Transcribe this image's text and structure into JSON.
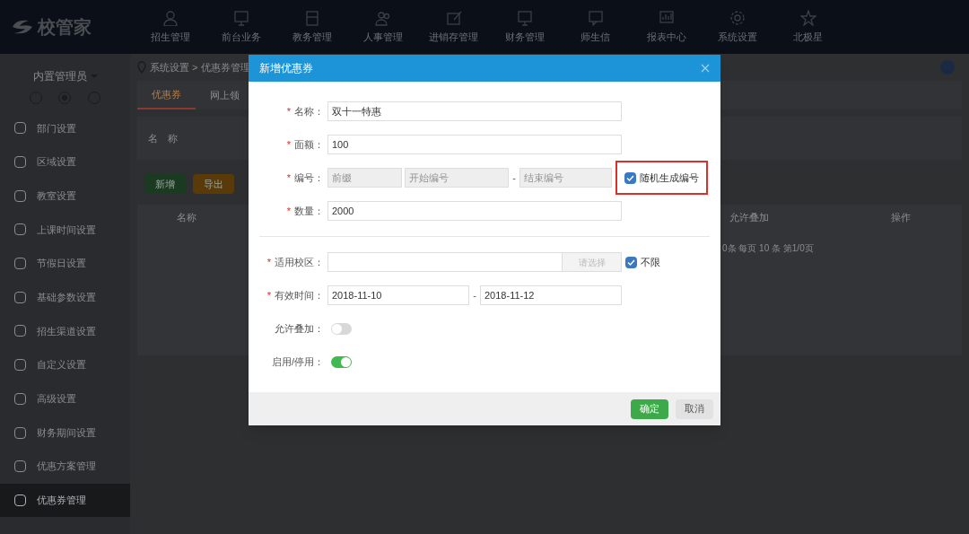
{
  "app": {
    "logo": "校管家"
  },
  "nav": [
    {
      "label": "招生管理"
    },
    {
      "label": "前台业务"
    },
    {
      "label": "教务管理"
    },
    {
      "label": "人事管理"
    },
    {
      "label": "进销存管理"
    },
    {
      "label": "财务管理"
    },
    {
      "label": "师生信"
    },
    {
      "label": "报表中心"
    },
    {
      "label": "系统设置"
    },
    {
      "label": "北极星"
    }
  ],
  "user": {
    "name": "内置管理员"
  },
  "sidebar": {
    "items": [
      {
        "label": "部门设置",
        "selected": false
      },
      {
        "label": "区域设置",
        "selected": false
      },
      {
        "label": "教室设置",
        "selected": false
      },
      {
        "label": "上课时间设置",
        "selected": false
      },
      {
        "label": "节假日设置",
        "selected": false
      },
      {
        "label": "基础参数设置",
        "selected": false
      },
      {
        "label": "招生渠道设置",
        "selected": false
      },
      {
        "label": "自定义设置",
        "selected": false
      },
      {
        "label": "高级设置",
        "selected": false
      },
      {
        "label": "财务期间设置",
        "selected": false
      },
      {
        "label": "优惠方案管理",
        "selected": false
      },
      {
        "label": "优惠券管理",
        "selected": true
      }
    ]
  },
  "breadcrumb": "系统设置 > 优惠券管理",
  "tabs": [
    {
      "label": "优惠券",
      "selected": true
    },
    {
      "label": "网上领",
      "selected": false
    }
  ],
  "filter": {
    "label": "名　称"
  },
  "buttons": [
    "新增",
    "导出"
  ],
  "table": {
    "columns": [
      "名称",
      "允许叠加",
      "操作"
    ]
  },
  "pagination": "0条 每页 10 条 第1/0页",
  "dialog": {
    "title": "新增优惠券",
    "fields": [
      {
        "kind": "text",
        "mark": "*",
        "label": "名称：",
        "value": "双十一特惠"
      },
      {
        "kind": "text",
        "mark": "*",
        "label": "面额：",
        "value": "100"
      },
      {
        "kind": "code",
        "mark": "*",
        "label": "编号：",
        "placeholders": [
          "前缀",
          "开始编号",
          "结束编号"
        ],
        "separator": "-",
        "option": {
          "label": "随机生成编号",
          "checked": true,
          "highlighted": true
        }
      },
      {
        "kind": "text",
        "mark": "*",
        "label": "数量：",
        "value": "2000"
      },
      {
        "kind": "divider"
      },
      {
        "kind": "pick",
        "mark": "*",
        "label": "适用校区：",
        "button": "请选择",
        "option": {
          "label": "不限",
          "checked": true
        }
      },
      {
        "kind": "range",
        "mark": "*",
        "label": "有效时间：",
        "values": [
          "2018-11-10",
          "2018-11-12"
        ],
        "separator": "-"
      },
      {
        "kind": "switch",
        "label": "允许叠加：",
        "on": false
      },
      {
        "kind": "switch",
        "label": "启用/停用：",
        "on": true
      }
    ],
    "ok": "确定",
    "cancel": "取消"
  }
}
